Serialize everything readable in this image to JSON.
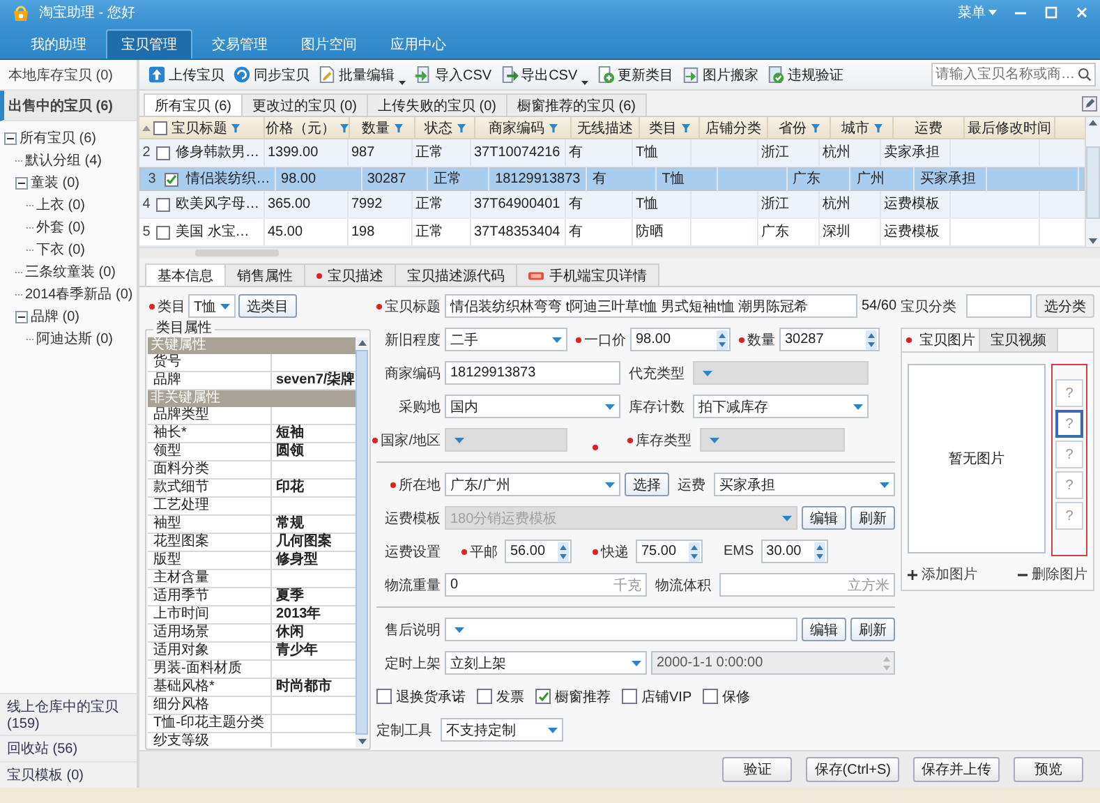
{
  "window": {
    "title": "淘宝助理 - 您好",
    "menu": "菜单"
  },
  "nav_tabs": [
    {
      "label": "我的助理",
      "selected": false
    },
    {
      "label": "宝贝管理",
      "selected": true
    },
    {
      "label": "交易管理",
      "selected": false
    },
    {
      "label": "图片空间",
      "selected": false
    },
    {
      "label": "应用中心",
      "selected": false
    }
  ],
  "sidebar": {
    "top_items": [
      {
        "label": "本地库存宝贝 (0)",
        "selected": false
      },
      {
        "label": "出售中的宝贝 (6)",
        "selected": true
      }
    ],
    "tree": [
      {
        "label": "所有宝贝 (6)",
        "expanded": true,
        "children": [
          {
            "label": "默认分组 (4)"
          },
          {
            "label": "童装 (0)",
            "expanded": true,
            "children": [
              {
                "label": "上衣 (0)"
              },
              {
                "label": "外套 (0)"
              },
              {
                "label": "下衣 (0)"
              }
            ]
          },
          {
            "label": "三条纹童装 (0)"
          },
          {
            "label": "2014春季新品 (0)"
          },
          {
            "label": "品牌 (0)",
            "expanded": true,
            "children": [
              {
                "label": "阿迪达斯 (0)"
              }
            ]
          }
        ]
      }
    ],
    "bottom_items": [
      "线上仓库中的宝贝 (159)",
      "回收站 (56)",
      "宝贝模板 (0)"
    ]
  },
  "toolbar": [
    {
      "label": "上传宝贝",
      "has_menu": false
    },
    {
      "label": "同步宝贝",
      "has_menu": false
    },
    {
      "label": "批量编辑",
      "has_menu": true
    },
    {
      "label": "导入CSV",
      "has_menu": false
    },
    {
      "label": "导出CSV",
      "has_menu": true
    },
    {
      "label": "更新类目",
      "has_menu": false
    },
    {
      "label": "图片搬家",
      "has_menu": false
    },
    {
      "label": "违规验证",
      "has_menu": false
    }
  ],
  "search": {
    "placeholder": "请输入宝贝名称或商…"
  },
  "list_tabs": [
    {
      "label": "所有宝贝 (6)",
      "selected": true
    },
    {
      "label": "更改过的宝贝 (0)",
      "selected": false
    },
    {
      "label": "上传失败的宝贝 (0)",
      "selected": false
    },
    {
      "label": "橱窗推荐的宝贝 (6)",
      "selected": false
    }
  ],
  "table": {
    "all_checked": false,
    "columns": [
      {
        "label": "宝贝标题",
        "filter": true
      },
      {
        "label": "价格（元）",
        "filter": true
      },
      {
        "label": "数量",
        "filter": true
      },
      {
        "label": "状态",
        "filter": true
      },
      {
        "label": "商家编码",
        "filter": true
      },
      {
        "label": "无线描述",
        "filter": false
      },
      {
        "label": "类目",
        "filter": true
      },
      {
        "label": "店铺分类",
        "filter": false
      },
      {
        "label": "省份",
        "filter": true
      },
      {
        "label": "城市",
        "filter": true
      },
      {
        "label": "运费",
        "filter": false
      },
      {
        "label": "最后修改时间",
        "filter": false
      }
    ],
    "rows": [
      {
        "number": "2",
        "checked": false,
        "selected": false,
        "cells": [
          "修身韩款男…",
          "1399.00",
          "987",
          "正常",
          "37T10074216",
          "有",
          "T恤",
          null,
          "浙江",
          "杭州",
          "卖家承担",
          null
        ]
      },
      {
        "number": "3",
        "checked": true,
        "selected": true,
        "cells": [
          "情侣装纺织…",
          "98.00",
          "30287",
          "正常",
          "18129913873",
          "有",
          "T恤",
          null,
          "广东",
          "广州",
          "买家承担",
          null
        ]
      },
      {
        "number": "4",
        "checked": false,
        "selected": false,
        "cells": [
          "欧美风字母…",
          "365.00",
          "7992",
          "正常",
          "37T64900401",
          "有",
          "T恤",
          null,
          "浙江",
          "杭州",
          "运费模板",
          null
        ]
      },
      {
        "number": "5",
        "checked": false,
        "selected": false,
        "cells": [
          "美国 水宝…",
          "45.00",
          "198",
          "正常",
          "37T48353404",
          "有",
          "防晒",
          null,
          "广东",
          "深圳",
          "运费模板",
          null
        ]
      }
    ]
  },
  "editor_tabs": [
    {
      "label": "基本信息",
      "selected": true,
      "kind": "plain"
    },
    {
      "label": "销售属性",
      "selected": false,
      "kind": "plain"
    },
    {
      "label": "宝贝描述",
      "selected": false,
      "kind": "required"
    },
    {
      "label": "宝贝描述源代码",
      "selected": false,
      "kind": "plain"
    },
    {
      "label": "手机端宝贝详情",
      "selected": false,
      "kind": "mobile"
    }
  ],
  "category": {
    "label": "类目",
    "required": true,
    "value": "T恤",
    "button": "选类目"
  },
  "attributes": {
    "title": "类目属性",
    "sections": [
      {
        "title": "关键属性",
        "rows": [
          {
            "name": "货号"
          },
          {
            "name": "品牌",
            "value": "seven7/柒牌"
          }
        ]
      },
      {
        "title": "非关键属性",
        "rows": [
          {
            "name": "品牌类型"
          },
          {
            "name": "袖长*",
            "value": "短袖"
          },
          {
            "name": "领型",
            "value": "圆领"
          },
          {
            "name": "面料分类"
          },
          {
            "name": "款式细节",
            "value": "印花"
          },
          {
            "name": "工艺处理"
          },
          {
            "name": "袖型",
            "value": "常规"
          },
          {
            "name": "花型图案",
            "value": "几何图案"
          },
          {
            "name": "版型",
            "value": "修身型"
          },
          {
            "name": "主材含量"
          },
          {
            "name": "适用季节",
            "value": "夏季"
          },
          {
            "name": "上市时间",
            "value": "2013年"
          },
          {
            "name": "适用场景",
            "value": "休闲"
          },
          {
            "name": "适用对象",
            "value": "青少年"
          },
          {
            "name": "男装-面料材质"
          },
          {
            "name": "基础风格*",
            "value": "时尚都市"
          },
          {
            "name": "细分风格"
          },
          {
            "name": "T恤-印花主题分类"
          },
          {
            "name": "纱支等级"
          }
        ]
      }
    ]
  },
  "form": {
    "title": {
      "label": "宝贝标题",
      "required": true,
      "value": "情侣装纺织林弯弯 t阿迪三叶草t恤 男式短袖t恤 潮男陈冠希",
      "counter": "54/60"
    },
    "condition": {
      "label": "新旧程度",
      "value": "二手"
    },
    "price": {
      "label": "一口价",
      "required": true,
      "value": "98.00"
    },
    "quantity": {
      "label": "数量",
      "required": true,
      "value": "30287"
    },
    "outer_id": {
      "label": "商家编码",
      "value": "18129913873"
    },
    "recharge_type": {
      "label": "代充类型",
      "disabled": true
    },
    "purchase_place": {
      "label": "采购地",
      "value": "国内"
    },
    "stock_count": {
      "label": "库存计数",
      "value": "拍下减库存"
    },
    "country": {
      "label": "国家/地区",
      "required": true,
      "disabled": true
    },
    "stock_type": {
      "label": "库存类型",
      "required": true,
      "disabled": true
    },
    "location": {
      "label": "所在地",
      "required": true,
      "value": "广东/广州",
      "button": "选择"
    },
    "freight": {
      "label": "运费",
      "value": "买家承担"
    },
    "freight_template": {
      "label": "运费模板",
      "value": "180分销运费模板",
      "disabled": true,
      "buttons": [
        "编辑",
        "刷新"
      ]
    },
    "freight_settings": {
      "label": "运费设置",
      "items": [
        {
          "label": "平邮",
          "required": true,
          "value": "56.00"
        },
        {
          "label": "快递",
          "required": true,
          "value": "75.00"
        },
        {
          "label": "EMS",
          "required": false,
          "value": "30.00"
        }
      ]
    },
    "weight": {
      "label": "物流重量",
      "value": "0",
      "unit": "千克"
    },
    "volume": {
      "label": "物流体积",
      "unit": "立方米"
    },
    "after_sale": {
      "label": "售后说明",
      "buttons": [
        "编辑",
        "刷新"
      ]
    },
    "scheduled": {
      "label": "定时上架",
      "value": "立刻上架",
      "time": "2000-1-1 0:00:00",
      "time_disabled": true
    },
    "options": [
      {
        "label": "退换货承诺",
        "checked": false
      },
      {
        "label": "发票",
        "checked": false
      },
      {
        "label": "橱窗推荐",
        "checked": true
      },
      {
        "label": "店铺VIP",
        "checked": false
      },
      {
        "label": "保修",
        "checked": false
      }
    ],
    "customization": {
      "label": "定制工具",
      "value": "不支持定制"
    }
  },
  "media": {
    "category_label": "宝贝分类",
    "category_button": "选分类",
    "tabs": [
      {
        "label": "宝贝图片",
        "selected": true,
        "required": true
      },
      {
        "label": "宝贝视频",
        "selected": false,
        "required": false
      }
    ],
    "empty_text": "暂无图片",
    "thumbnails": [
      {
        "label": "?",
        "selected": false
      },
      {
        "label": "?",
        "selected": true
      },
      {
        "label": "?",
        "selected": false
      },
      {
        "label": "?",
        "selected": false
      },
      {
        "label": "?",
        "selected": false
      }
    ],
    "add": "添加图片",
    "remove": "删除图片"
  },
  "actions": [
    "验证",
    "保存(Ctrl+S)",
    "保存并上传",
    "预览"
  ]
}
